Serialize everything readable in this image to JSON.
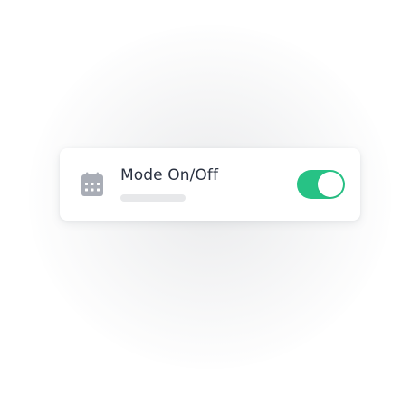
{
  "setting_card": {
    "title": "Mode On/Off",
    "icon": "calendar-icon",
    "toggle": {
      "state": "on",
      "on_color": "#27c285"
    }
  }
}
